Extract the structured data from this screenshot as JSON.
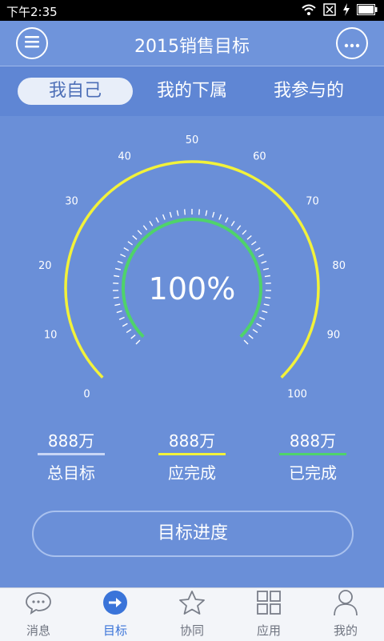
{
  "status": {
    "time": "下午2:35",
    "battery_icon": "battery-icon",
    "wifi_icon": "wifi-icon",
    "signal_icon": "signal-icon"
  },
  "header": {
    "title": "2015销售目标",
    "menu_icon": "menu-icon",
    "more_icon": "more-icon"
  },
  "tabs": [
    {
      "label": "我自己",
      "active": true
    },
    {
      "label": "我的下属",
      "active": false
    },
    {
      "label": "我参与的",
      "active": false
    }
  ],
  "gauge": {
    "percent_text": "100%",
    "value": 100,
    "min": 0,
    "max": 100,
    "ticks": [
      "0",
      "10",
      "20",
      "30",
      "40",
      "50",
      "60",
      "70",
      "80",
      "90",
      "100"
    ],
    "outer_color": "#f2f23a",
    "inner_color": "#4fd36a"
  },
  "stats": [
    {
      "value": "888万",
      "label": "总目标",
      "color": "#c9d6f5"
    },
    {
      "value": "888万",
      "label": "应完成",
      "color": "#f2f23a"
    },
    {
      "value": "888万",
      "label": "已完成",
      "color": "#4fd36a"
    }
  ],
  "progress_button": {
    "label": "目标进度"
  },
  "bottom_nav": [
    {
      "label": "消息",
      "icon": "message-icon",
      "active": false
    },
    {
      "label": "目标",
      "icon": "target-arrow-icon",
      "active": true
    },
    {
      "label": "协同",
      "icon": "star-icon",
      "active": false
    },
    {
      "label": "应用",
      "icon": "grid-icon",
      "active": false
    },
    {
      "label": "我的",
      "icon": "person-icon",
      "active": false
    }
  ]
}
